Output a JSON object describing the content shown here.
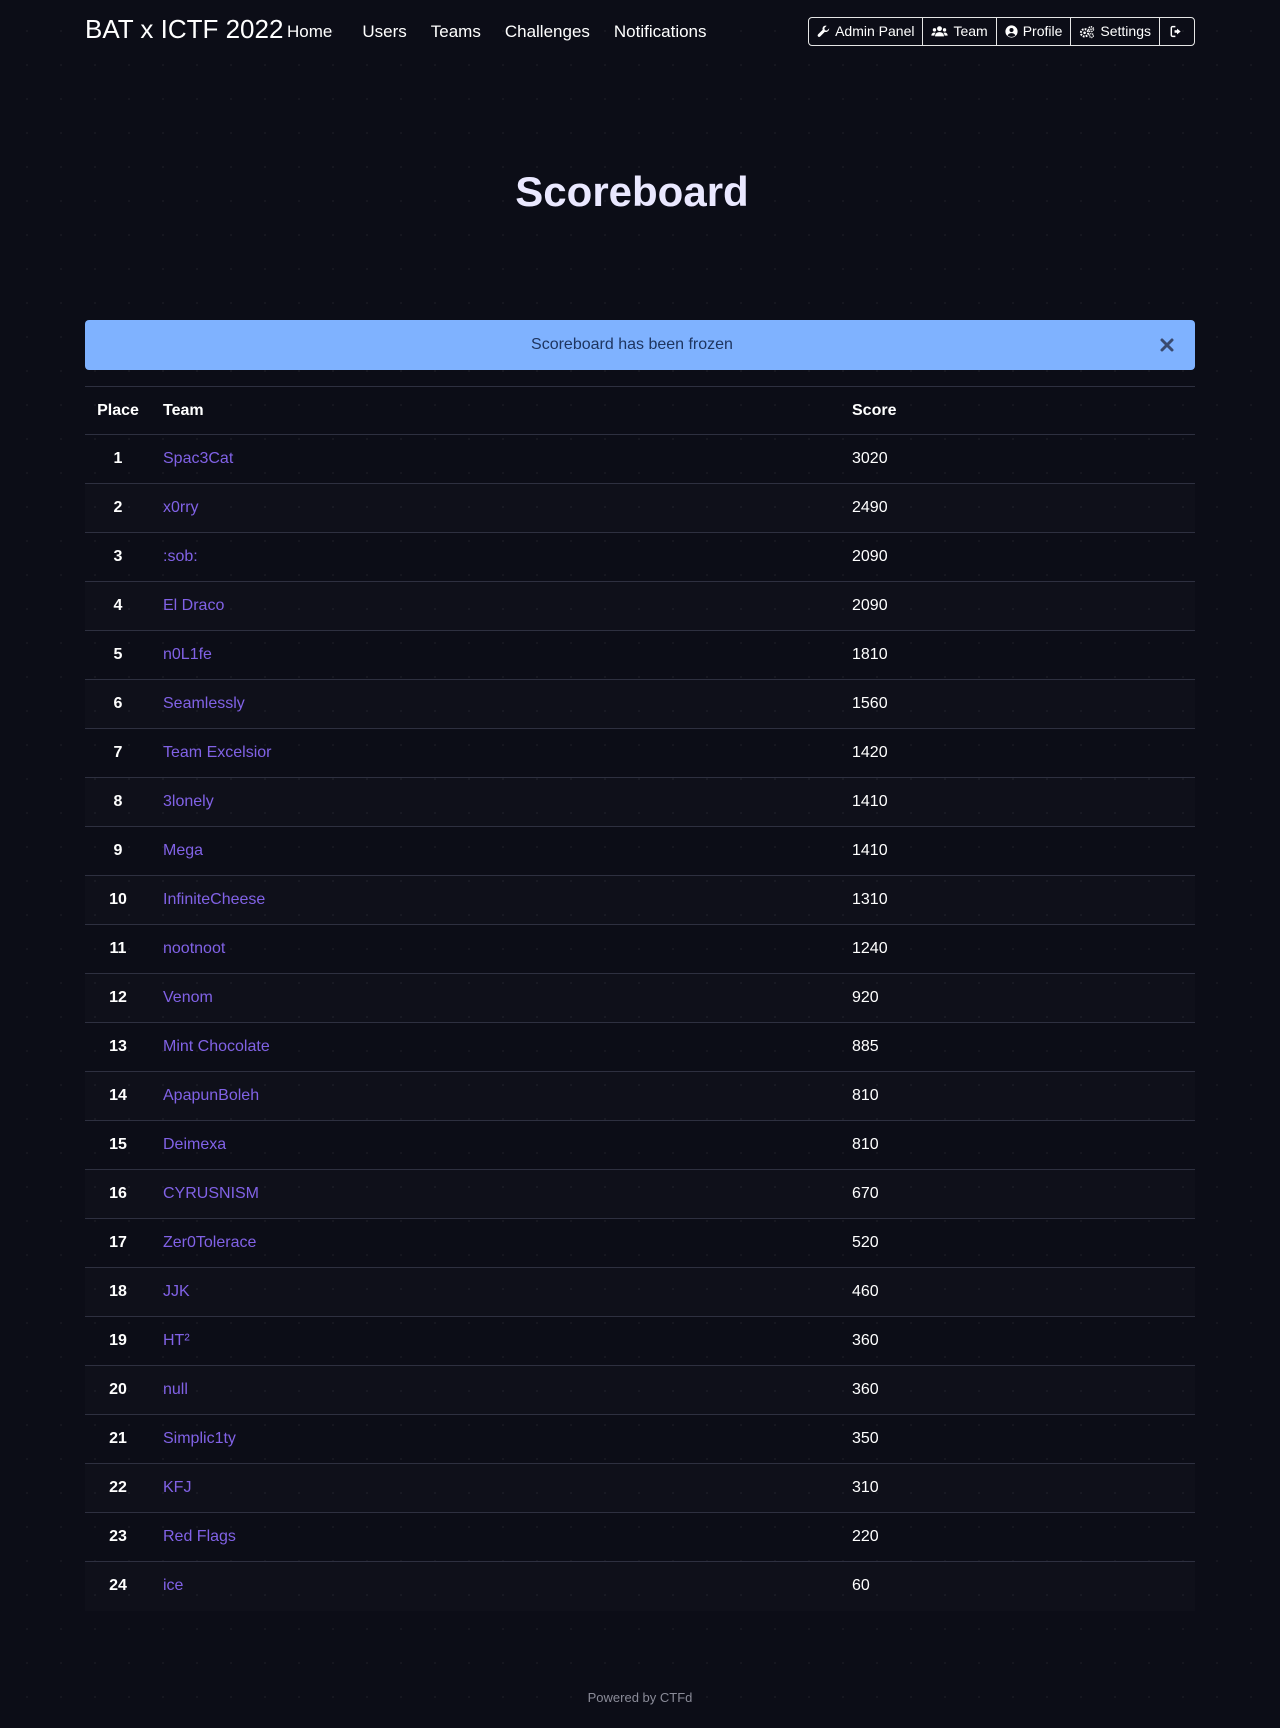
{
  "brand": "BAT x ICTF 2022",
  "nav": {
    "home": "Home",
    "users": "Users",
    "teams": "Teams",
    "challenges": "Challenges",
    "notifications": "Notifications"
  },
  "actions": {
    "admin_panel": "Admin Panel",
    "team": "Team",
    "profile": "Profile",
    "settings": "Settings"
  },
  "icons": {
    "admin_panel": "wrench-icon",
    "team": "users-icon",
    "profile": "user-circle-icon",
    "settings": "cogs-icon",
    "logout": "sign-out-icon",
    "alert_close": "close-icon"
  },
  "page_title": "Scoreboard",
  "alert": {
    "text": "Scoreboard has been frozen"
  },
  "table": {
    "headers": {
      "place": "Place",
      "team": "Team",
      "score": "Score"
    },
    "rows": [
      {
        "place": "1",
        "team": "Spac3Cat",
        "score": "3020"
      },
      {
        "place": "2",
        "team": "x0rry",
        "score": "2490"
      },
      {
        "place": "3",
        "team": ":sob:",
        "score": "2090"
      },
      {
        "place": "4",
        "team": "El Draco",
        "score": "2090"
      },
      {
        "place": "5",
        "team": "n0L1fe",
        "score": "1810"
      },
      {
        "place": "6",
        "team": "Seamlessly",
        "score": "1560"
      },
      {
        "place": "7",
        "team": "Team Excelsior",
        "score": "1420"
      },
      {
        "place": "8",
        "team": "3lonely",
        "score": "1410"
      },
      {
        "place": "9",
        "team": "Mega",
        "score": "1410"
      },
      {
        "place": "10",
        "team": "InfiniteCheese",
        "score": "1310"
      },
      {
        "place": "11",
        "team": "nootnoot",
        "score": "1240"
      },
      {
        "place": "12",
        "team": "Venom",
        "score": "920"
      },
      {
        "place": "13",
        "team": "Mint Chocolate",
        "score": "885"
      },
      {
        "place": "14",
        "team": "ApapunBoleh",
        "score": "810"
      },
      {
        "place": "15",
        "team": "Deimexa",
        "score": "810"
      },
      {
        "place": "16",
        "team": "CYRUSNISM",
        "score": "670"
      },
      {
        "place": "17",
        "team": "Zer0Tolerace",
        "score": "520"
      },
      {
        "place": "18",
        "team": "JJK",
        "score": "460"
      },
      {
        "place": "19",
        "team": "HT²",
        "score": "360"
      },
      {
        "place": "20",
        "team": "null",
        "score": "360"
      },
      {
        "place": "21",
        "team": "Simplic1ty",
        "score": "350"
      },
      {
        "place": "22",
        "team": "KFJ",
        "score": "310"
      },
      {
        "place": "23",
        "team": "Red Flags",
        "score": "220"
      },
      {
        "place": "24",
        "team": "ice",
        "score": "60"
      }
    ]
  },
  "footer": "Powered by CTFd",
  "colors": {
    "background": "#0c0d17",
    "link": "#8162e6",
    "alert_bg": "#7fb2ff",
    "alert_text": "#1e3560",
    "title": "#eae8ff"
  }
}
